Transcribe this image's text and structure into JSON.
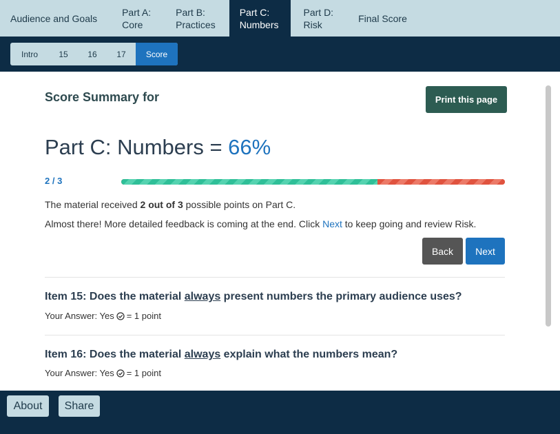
{
  "top_nav": {
    "tabs": [
      {
        "line1": "Audience and Goals",
        "line2": ""
      },
      {
        "line1": "Part A:",
        "line2": "Core"
      },
      {
        "line1": "Part B:",
        "line2": "Practices"
      },
      {
        "line1": "Part C:",
        "line2": "Numbers"
      },
      {
        "line1": "Part D:",
        "line2": "Risk"
      },
      {
        "line1": "Final Score",
        "line2": ""
      }
    ],
    "active_index": 3
  },
  "sub_nav": {
    "items": [
      "Intro",
      "15",
      "16",
      "17",
      "Score"
    ],
    "active_index": 4
  },
  "summary": {
    "label": "Score Summary for",
    "print_button": "Print this page"
  },
  "score": {
    "title_prefix": "Part C: Numbers = ",
    "percent_text": "66%",
    "fraction_text": "2 / 3",
    "points": 2,
    "possible": 3,
    "progress_fraction": 0.667
  },
  "message": {
    "line1_pre": "The material received ",
    "line1_bold": "2 out of 3",
    "line1_post": " possible points on Part C.",
    "line2_pre": "Almost there! More detailed feedback is coming at the end. Click ",
    "line2_link": "Next",
    "line2_post": " to keep going and review Risk."
  },
  "buttons": {
    "back": "Back",
    "next": "Next"
  },
  "items": [
    {
      "q_pre": "Item 15: Does the material ",
      "q_underline": "always",
      "q_post": " present numbers the primary audience uses?",
      "answer_pre": "Your Answer: Yes",
      "answer_post": "= 1 point"
    },
    {
      "q_pre": "Item 16: Does the material ",
      "q_underline": "always",
      "q_post": " explain what the numbers mean?",
      "answer_pre": "Your Answer: Yes",
      "answer_post": "= 1 point"
    }
  ],
  "footer": {
    "about": "About",
    "share": "Share"
  },
  "colors": {
    "nav_light": "#c5dbe2",
    "nav_dark": "#0d2c45",
    "accent_blue": "#1e73be",
    "print_green": "#2d5c52",
    "progress_good": "#2fbf98",
    "progress_bad": "#e0533f"
  }
}
